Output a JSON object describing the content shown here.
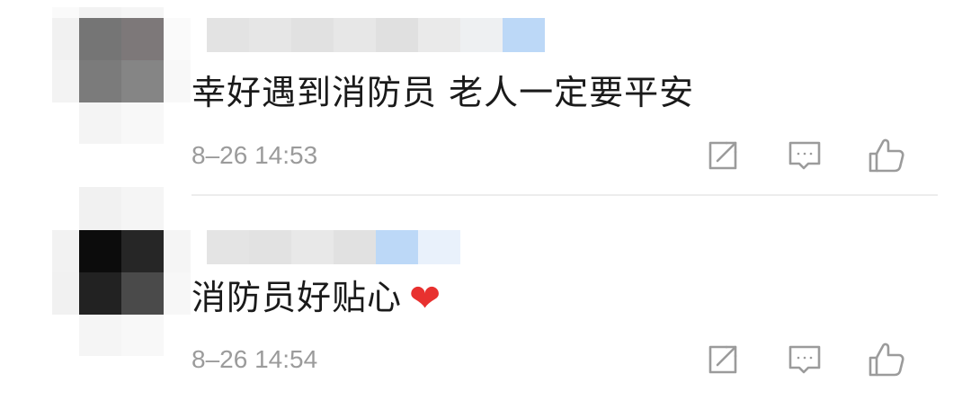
{
  "comments": [
    {
      "text": "幸好遇到消防员 老人一定要平安",
      "time": "8–26 14:53",
      "emoji": "",
      "actions": [
        {
          "icon": "share-icon"
        },
        {
          "icon": "comment-icon"
        },
        {
          "icon": "like-icon"
        }
      ]
    },
    {
      "text": "消防员好贴心",
      "time": "8–26 14:54",
      "emoji": "❤",
      "actions": [
        {
          "icon": "share-icon"
        },
        {
          "icon": "comment-icon"
        },
        {
          "icon": "like-icon"
        }
      ]
    }
  ],
  "colors": {
    "text": "#1a1a1a",
    "meta": "#9b9b9b",
    "icon": "#9b9b9b",
    "heart": "#e8312f",
    "divider": "#ededed",
    "name_bar_accent": "#bcd8f7"
  }
}
